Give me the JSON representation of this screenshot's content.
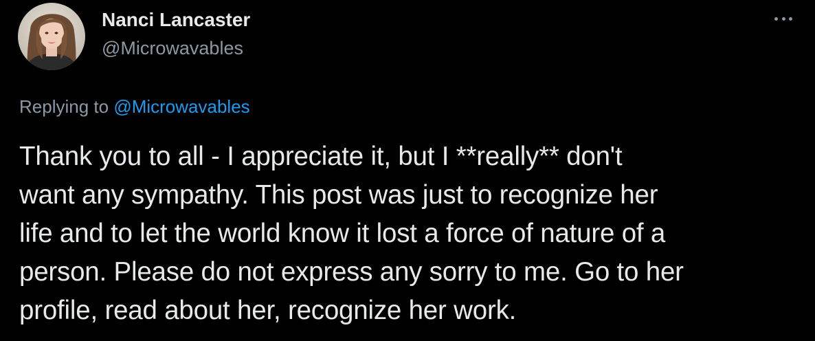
{
  "author": {
    "display_name": "Nanci Lancaster",
    "handle": "@Microwavables",
    "avatar_icon": "profile-photo"
  },
  "menu": {
    "icon": "more-options-icon"
  },
  "reply": {
    "prefix": "Replying to",
    "mention": "@Microwavables"
  },
  "tweet": {
    "lines": [
      "Thank you to all - I appreciate it, but I **really** don't",
      "want any sympathy. This post was just to recognize her",
      "life and to let the world know it lost a force of nature of a",
      "person. Please do not express any sorry to me. Go to her",
      "profile, read about her, recognize her work."
    ]
  },
  "colors": {
    "background": "#000000",
    "text_primary": "#e7e9ea",
    "text_secondary": "#8b98a5",
    "link": "#1d9bf0"
  }
}
